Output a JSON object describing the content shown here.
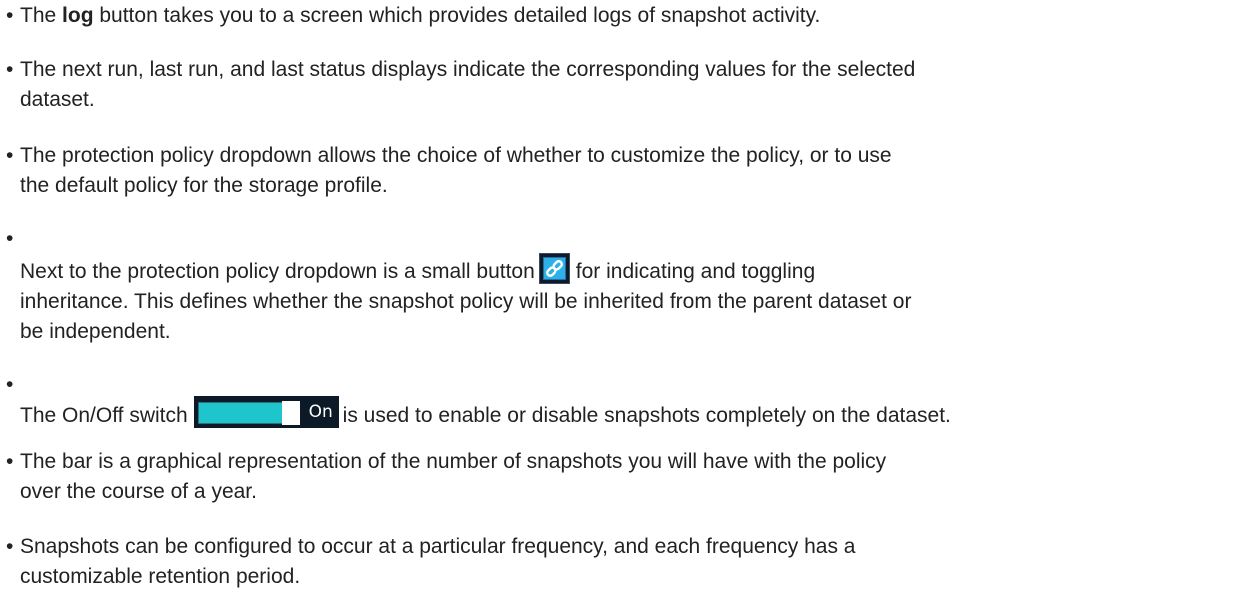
{
  "bullets": [
    {
      "lines": [
        {
          "pre": "The ",
          "bold": "log",
          "post": " button takes you to a screen which provides detailed logs of snapshot activity."
        }
      ]
    },
    {
      "lines": [
        "The next run, last run, and last status displays indicate the corresponding values for the selected",
        "dataset."
      ]
    },
    {
      "lines": [
        "The protection policy dropdown allows the choice of whether to customize the policy, or to use",
        "the default policy for the storage profile."
      ]
    },
    {
      "lines": [
        {
          "pre": "Next to the protection policy dropdown is a small button",
          "icon": "chain-link-icon",
          "post": "for indicating and toggling"
        },
        "inheritance. This defines whether the snapshot policy will be inherited from the parent dataset or",
        "be independent."
      ]
    },
    {
      "lines": [
        {
          "pre": "The On/Off switch",
          "switch_state": "On",
          "post": "is used to enable or disable snapshots completely on the dataset."
        }
      ]
    },
    {
      "lines": [
        "The bar is a graphical representation of the number of snapshots you will have with the policy",
        "over the course of a year."
      ]
    },
    {
      "lines": [
        "Snapshots can be configured to occur at a particular frequency, and each frequency has a",
        "customizable retention period."
      ]
    }
  ],
  "bullet_glyph": "•",
  "colors": {
    "text": "#222222",
    "switch_track": "#1ec5cc",
    "switch_bg": "#0b1a26",
    "icon_bg": "#0f1a2a",
    "icon_accent": "#2bb0e8"
  }
}
